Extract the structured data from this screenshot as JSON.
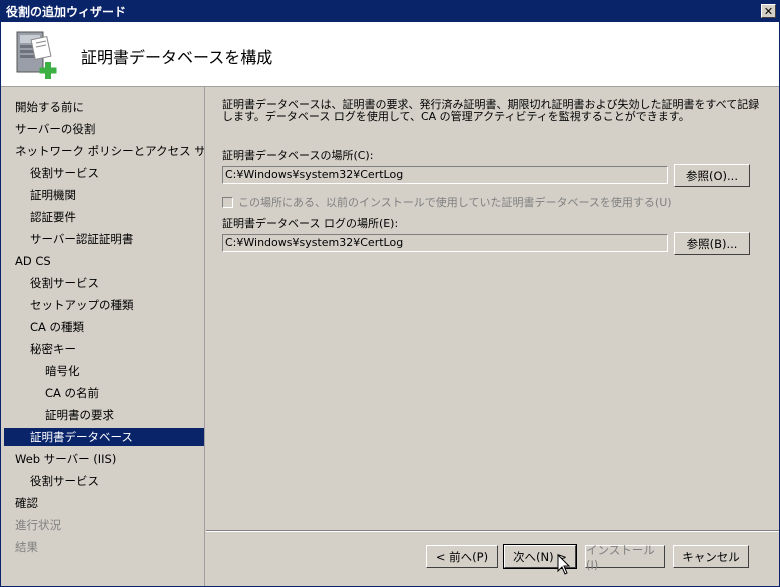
{
  "window": {
    "title": "役割の追加ウィザード",
    "close_glyph": "✕"
  },
  "header": {
    "title": "証明書データベースを構成"
  },
  "sidebar": {
    "items": [
      {
        "label": "開始する前に",
        "level": 0,
        "state": "normal"
      },
      {
        "label": "サーバーの役割",
        "level": 0,
        "state": "normal"
      },
      {
        "label": "ネットワーク ポリシーとアクセス サービ...",
        "level": 0,
        "state": "normal"
      },
      {
        "label": "役割サービス",
        "level": 1,
        "state": "normal"
      },
      {
        "label": "証明機関",
        "level": 1,
        "state": "normal"
      },
      {
        "label": "認証要件",
        "level": 1,
        "state": "normal"
      },
      {
        "label": "サーバー認証証明書",
        "level": 1,
        "state": "normal"
      },
      {
        "label": "AD CS",
        "level": 0,
        "state": "normal"
      },
      {
        "label": "役割サービス",
        "level": 1,
        "state": "normal"
      },
      {
        "label": "セットアップの種類",
        "level": 1,
        "state": "normal"
      },
      {
        "label": "CA の種類",
        "level": 1,
        "state": "normal"
      },
      {
        "label": "秘密キー",
        "level": 1,
        "state": "normal"
      },
      {
        "label": "暗号化",
        "level": 2,
        "state": "normal"
      },
      {
        "label": "CA の名前",
        "level": 2,
        "state": "normal"
      },
      {
        "label": "証明書の要求",
        "level": 2,
        "state": "normal"
      },
      {
        "label": "証明書データベース",
        "level": 1,
        "state": "selected"
      },
      {
        "label": "Web サーバー (IIS)",
        "level": 0,
        "state": "normal"
      },
      {
        "label": "役割サービス",
        "level": 1,
        "state": "normal"
      },
      {
        "label": "確認",
        "level": 0,
        "state": "normal"
      },
      {
        "label": "進行状況",
        "level": 0,
        "state": "disabled"
      },
      {
        "label": "結果",
        "level": 0,
        "state": "disabled"
      }
    ]
  },
  "main": {
    "description": "証明書データベースは、証明書の要求、発行済み証明書、期限切れ証明書および失効した証明書をすべて記録します。データベース ログを使用して、CA の管理アクティビティを監視することができます。",
    "db_location_label": "証明書データベースの場所(C):",
    "db_location_value": "C:¥Windows¥system32¥CertLog",
    "browse_db_label": "参照(O)...",
    "reuse_checkbox_label": "この場所にある、以前のインストールで使用していた証明書データベースを使用する(U)",
    "reuse_checked": false,
    "log_location_label": "証明書データベース ログの場所(E):",
    "log_location_value": "C:¥Windows¥system32¥CertLog",
    "browse_log_label": "参照(B)..."
  },
  "footer": {
    "back_label": "< 前へ(P)",
    "next_label": "次へ(N) >",
    "install_label": "インストール(I)",
    "cancel_label": "キャンセル"
  },
  "colors": {
    "titlebar": "#0a246a",
    "selected_bg": "#0a246a",
    "face": "#d4d0c8",
    "icon_plus": "#3cb043"
  }
}
